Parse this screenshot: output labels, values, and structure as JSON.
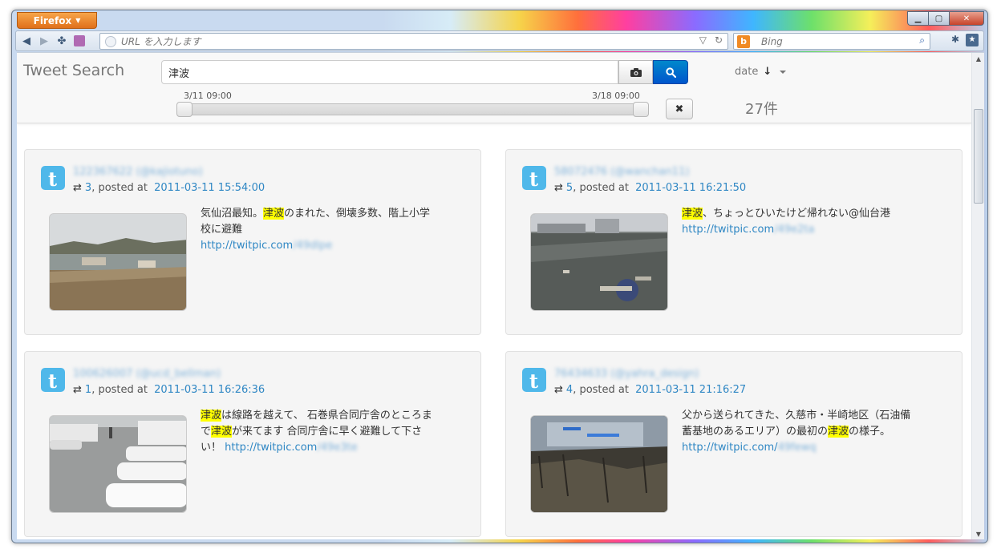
{
  "browser": {
    "menu_label": "Firefox",
    "url_placeholder": "URL を入力します",
    "search_engine": "Bing"
  },
  "app": {
    "brand": "Tweet Search",
    "query": "津波",
    "sort_label": "date",
    "range_start": "3/11 09:00",
    "range_end": "3/18 09:00",
    "result_count": "27件",
    "clear_glyph": "✖"
  },
  "tweets": [
    {
      "user": "122367622 (@kajiotuno)",
      "retweets": "3",
      "posted_prefix": ", posted at ",
      "date": "2011-03-11 15:54:00",
      "text_1": "気仙沼最知。",
      "hl_1": "津波",
      "text_2": "のまれた、倒壊多数、階上小学校に避難",
      "hl_2": "",
      "text_3": "",
      "link": "http://twitpic.com",
      "link_tail": "/49dlpe"
    },
    {
      "user": "58072476 (@wanchan11)",
      "retweets": "5",
      "posted_prefix": ", posted at ",
      "date": "2011-03-11 16:21:50",
      "text_1": "",
      "hl_1": "津波",
      "text_2": "、ちょっとひいたけど帰れない@仙台港 ",
      "hl_2": "",
      "text_3": "",
      "link": "http://twitpic.com",
      "link_tail": "/49e2ta"
    },
    {
      "user": "100626007 (@ucd_bellman)",
      "retweets": "1",
      "posted_prefix": ", posted at ",
      "date": "2011-03-11 16:26:36",
      "text_1": "",
      "hl_1": "津波",
      "text_2": "は線路を越えて、 石巻県合同庁舎のところまで",
      "hl_2": "津波",
      "text_3": "が来てます 合同庁舎に早く避難して下さい！ ",
      "link": "http://twitpic.com",
      "link_tail": "/49e3te"
    },
    {
      "user": "76434633 (@yahra_design)",
      "retweets": "4",
      "posted_prefix": ", posted at ",
      "date": "2011-03-11 21:16:27",
      "text_1": "父から送られてきた、久慈市・半崎地区（石油備蓄基地のあるエリア）の最初の",
      "hl_1": "津波",
      "text_2": "の様子。 ",
      "hl_2": "",
      "text_3": "",
      "link": "http://twitpic.com/",
      "link_tail": "49fewq"
    }
  ],
  "colors": {
    "accent": "#0066cc",
    "link": "#2f87c4",
    "highlight": "#ffff00",
    "twitter": "#4fb8ea"
  }
}
